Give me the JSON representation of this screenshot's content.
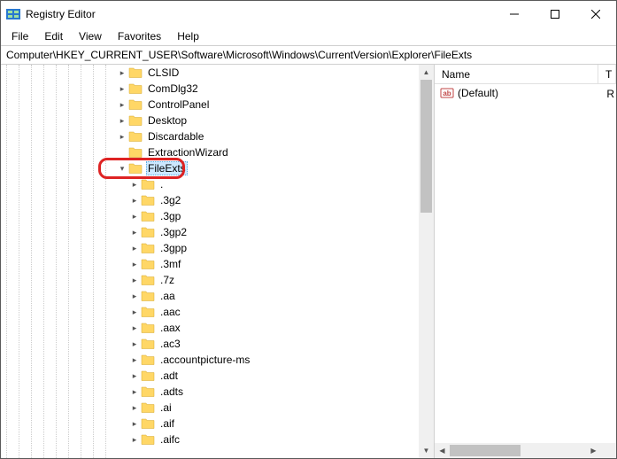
{
  "window": {
    "title": "Registry Editor"
  },
  "menu": {
    "file": "File",
    "edit": "Edit",
    "view": "View",
    "favorites": "Favorites",
    "help": "Help"
  },
  "address": "Computer\\HKEY_CURRENT_USER\\Software\\Microsoft\\Windows\\CurrentVersion\\Explorer\\FileExts",
  "tree": {
    "selected_label": "FileExts",
    "items_above": [
      {
        "label": "CLSID",
        "indent": 9,
        "expander": ">"
      },
      {
        "label": "ComDlg32",
        "indent": 9,
        "expander": ">"
      },
      {
        "label": "ControlPanel",
        "indent": 9,
        "expander": ">"
      },
      {
        "label": "Desktop",
        "indent": 9,
        "expander": ">"
      },
      {
        "label": "Discardable",
        "indent": 9,
        "expander": ">"
      },
      {
        "label": "ExtractionWizard",
        "indent": 9,
        "expander": ""
      }
    ],
    "selected": {
      "label": "FileExts",
      "indent": 9,
      "expander": "v"
    },
    "items_below": [
      {
        "label": ".",
        "indent": 10,
        "expander": ">"
      },
      {
        "label": ".3g2",
        "indent": 10,
        "expander": ">"
      },
      {
        "label": ".3gp",
        "indent": 10,
        "expander": ">"
      },
      {
        "label": ".3gp2",
        "indent": 10,
        "expander": ">"
      },
      {
        "label": ".3gpp",
        "indent": 10,
        "expander": ">"
      },
      {
        "label": ".3mf",
        "indent": 10,
        "expander": ">"
      },
      {
        "label": ".7z",
        "indent": 10,
        "expander": ">"
      },
      {
        "label": ".aa",
        "indent": 10,
        "expander": ">"
      },
      {
        "label": ".aac",
        "indent": 10,
        "expander": ">"
      },
      {
        "label": ".aax",
        "indent": 10,
        "expander": ">"
      },
      {
        "label": ".ac3",
        "indent": 10,
        "expander": ">"
      },
      {
        "label": ".accountpicture-ms",
        "indent": 10,
        "expander": ">"
      },
      {
        "label": ".adt",
        "indent": 10,
        "expander": ">"
      },
      {
        "label": ".adts",
        "indent": 10,
        "expander": ">"
      },
      {
        "label": ".ai",
        "indent": 10,
        "expander": ">"
      },
      {
        "label": ".aif",
        "indent": 10,
        "expander": ">"
      },
      {
        "label": ".aifc",
        "indent": 10,
        "expander": ">"
      }
    ]
  },
  "values": {
    "columns": {
      "name": "Name",
      "type": "T"
    },
    "rows": [
      {
        "name": "(Default)",
        "type": "R"
      }
    ]
  }
}
